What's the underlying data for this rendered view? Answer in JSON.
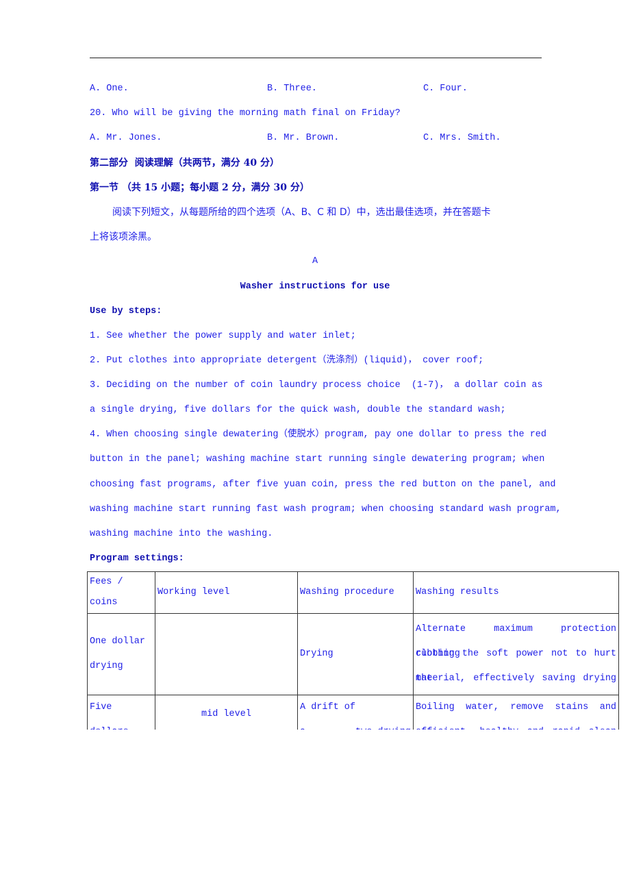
{
  "q19_options": {
    "a": "A. One.",
    "b": "B. Three.",
    "c": "C. Four."
  },
  "q20": {
    "question": "20. Who will be giving the morning math final on Friday?",
    "a": "A. Mr. Jones.",
    "b": "B. Mr. Brown.",
    "c": "C. Mrs. Smith."
  },
  "part2_heading": "第二部分  阅读理解（共两节，满分 40 分）",
  "section1_heading": "第一节 （共 15 小题；每小题 2 分，满分 30 分）",
  "instructions": [
    "阅读下列短文，从每题所给的四个选项（A、B、C 和 D）中，选出最佳选项，并在答题卡",
    "上将该项涂黑。"
  ],
  "passage_letter": "A",
  "passage_title": "Washer instructions for use",
  "steps_heading": "Use by steps:",
  "steps_lines": [
    "1. See whether the power supply and water inlet;",
    "2. Put clothes into appropriate detergent（洗涤剂）(liquid)， cover roof;",
    "3. Deciding on the number of coin laundry process choice  (1-7)， a dollar coin as",
    "a single drying, five dollars for the quick wash, double the standard wash;",
    "4. When choosing single dewatering（使脱水）program, pay one dollar to press the red",
    "button in the panel; washing machine start running single dewatering program; when",
    "choosing fast programs, after five yuan coin, press the red button on the panel, and",
    "washing machine start running fast wash program; when choosing standard wash program,",
    "washing machine into the washing."
  ],
  "program_heading": "Program settings:",
  "table": {
    "headers": [
      "Fees / coins",
      "Working level",
      "Washing procedure",
      "Washing results"
    ],
    "rows": [
      {
        "fees": [
          "One dollar",
          "drying"
        ],
        "level": "",
        "procedure": [
          "Drying"
        ],
        "results": [
          "Alternate maximum protection clothing",
          "rubbing the soft power not to hurt the",
          "material,  effectively  saving  drying"
        ]
      },
      {
        "fees": [
          "Five",
          "dollars"
        ],
        "level": "mid level",
        "procedure": [
          "A drift of",
          "a         two-drying"
        ],
        "results": [
          "Boiling   water,   remove   stains   and",
          "efficient,  healthy  and  rapid  clean"
        ]
      }
    ]
  },
  "colors": {
    "text": "#1f1fe6",
    "heading": "#1010b0"
  }
}
